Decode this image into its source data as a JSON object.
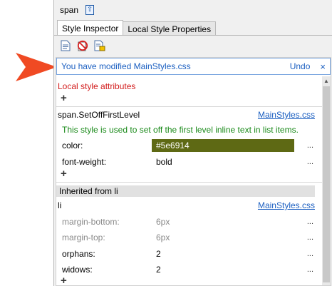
{
  "panel_title": "span",
  "tabs": [
    {
      "label": "Style Inspector"
    },
    {
      "label": "Local Style Properties"
    }
  ],
  "toolbar": {
    "icons": [
      "document-icon",
      "no-entry-icon",
      "edit-document-icon"
    ]
  },
  "banner": {
    "message": "You have modified  MainStyles.css",
    "undo": "Undo",
    "close": "×"
  },
  "local": {
    "heading": "Local style attributes",
    "add": "+"
  },
  "rule": {
    "selector": "span.SetOffFirstLevel",
    "source": "MainStyles.css",
    "description": "This style is used to set off the first level inline text in list items.",
    "properties": [
      {
        "name": "color:",
        "value": "#5e6914",
        "swatch": "#5e6914"
      },
      {
        "name": "font-weight:",
        "value": "bold"
      }
    ],
    "add": "+"
  },
  "inherited": {
    "heading": "Inherited from li",
    "selector": "li",
    "source": "MainStyles.css",
    "properties": [
      {
        "name": "margin-bottom:",
        "value": "6px"
      },
      {
        "name": "margin-top:",
        "value": "6px"
      },
      {
        "name": "orphans:",
        "value": "2"
      },
      {
        "name": "widows:",
        "value": "2"
      }
    ],
    "add": "+"
  },
  "ellipsis": "..."
}
